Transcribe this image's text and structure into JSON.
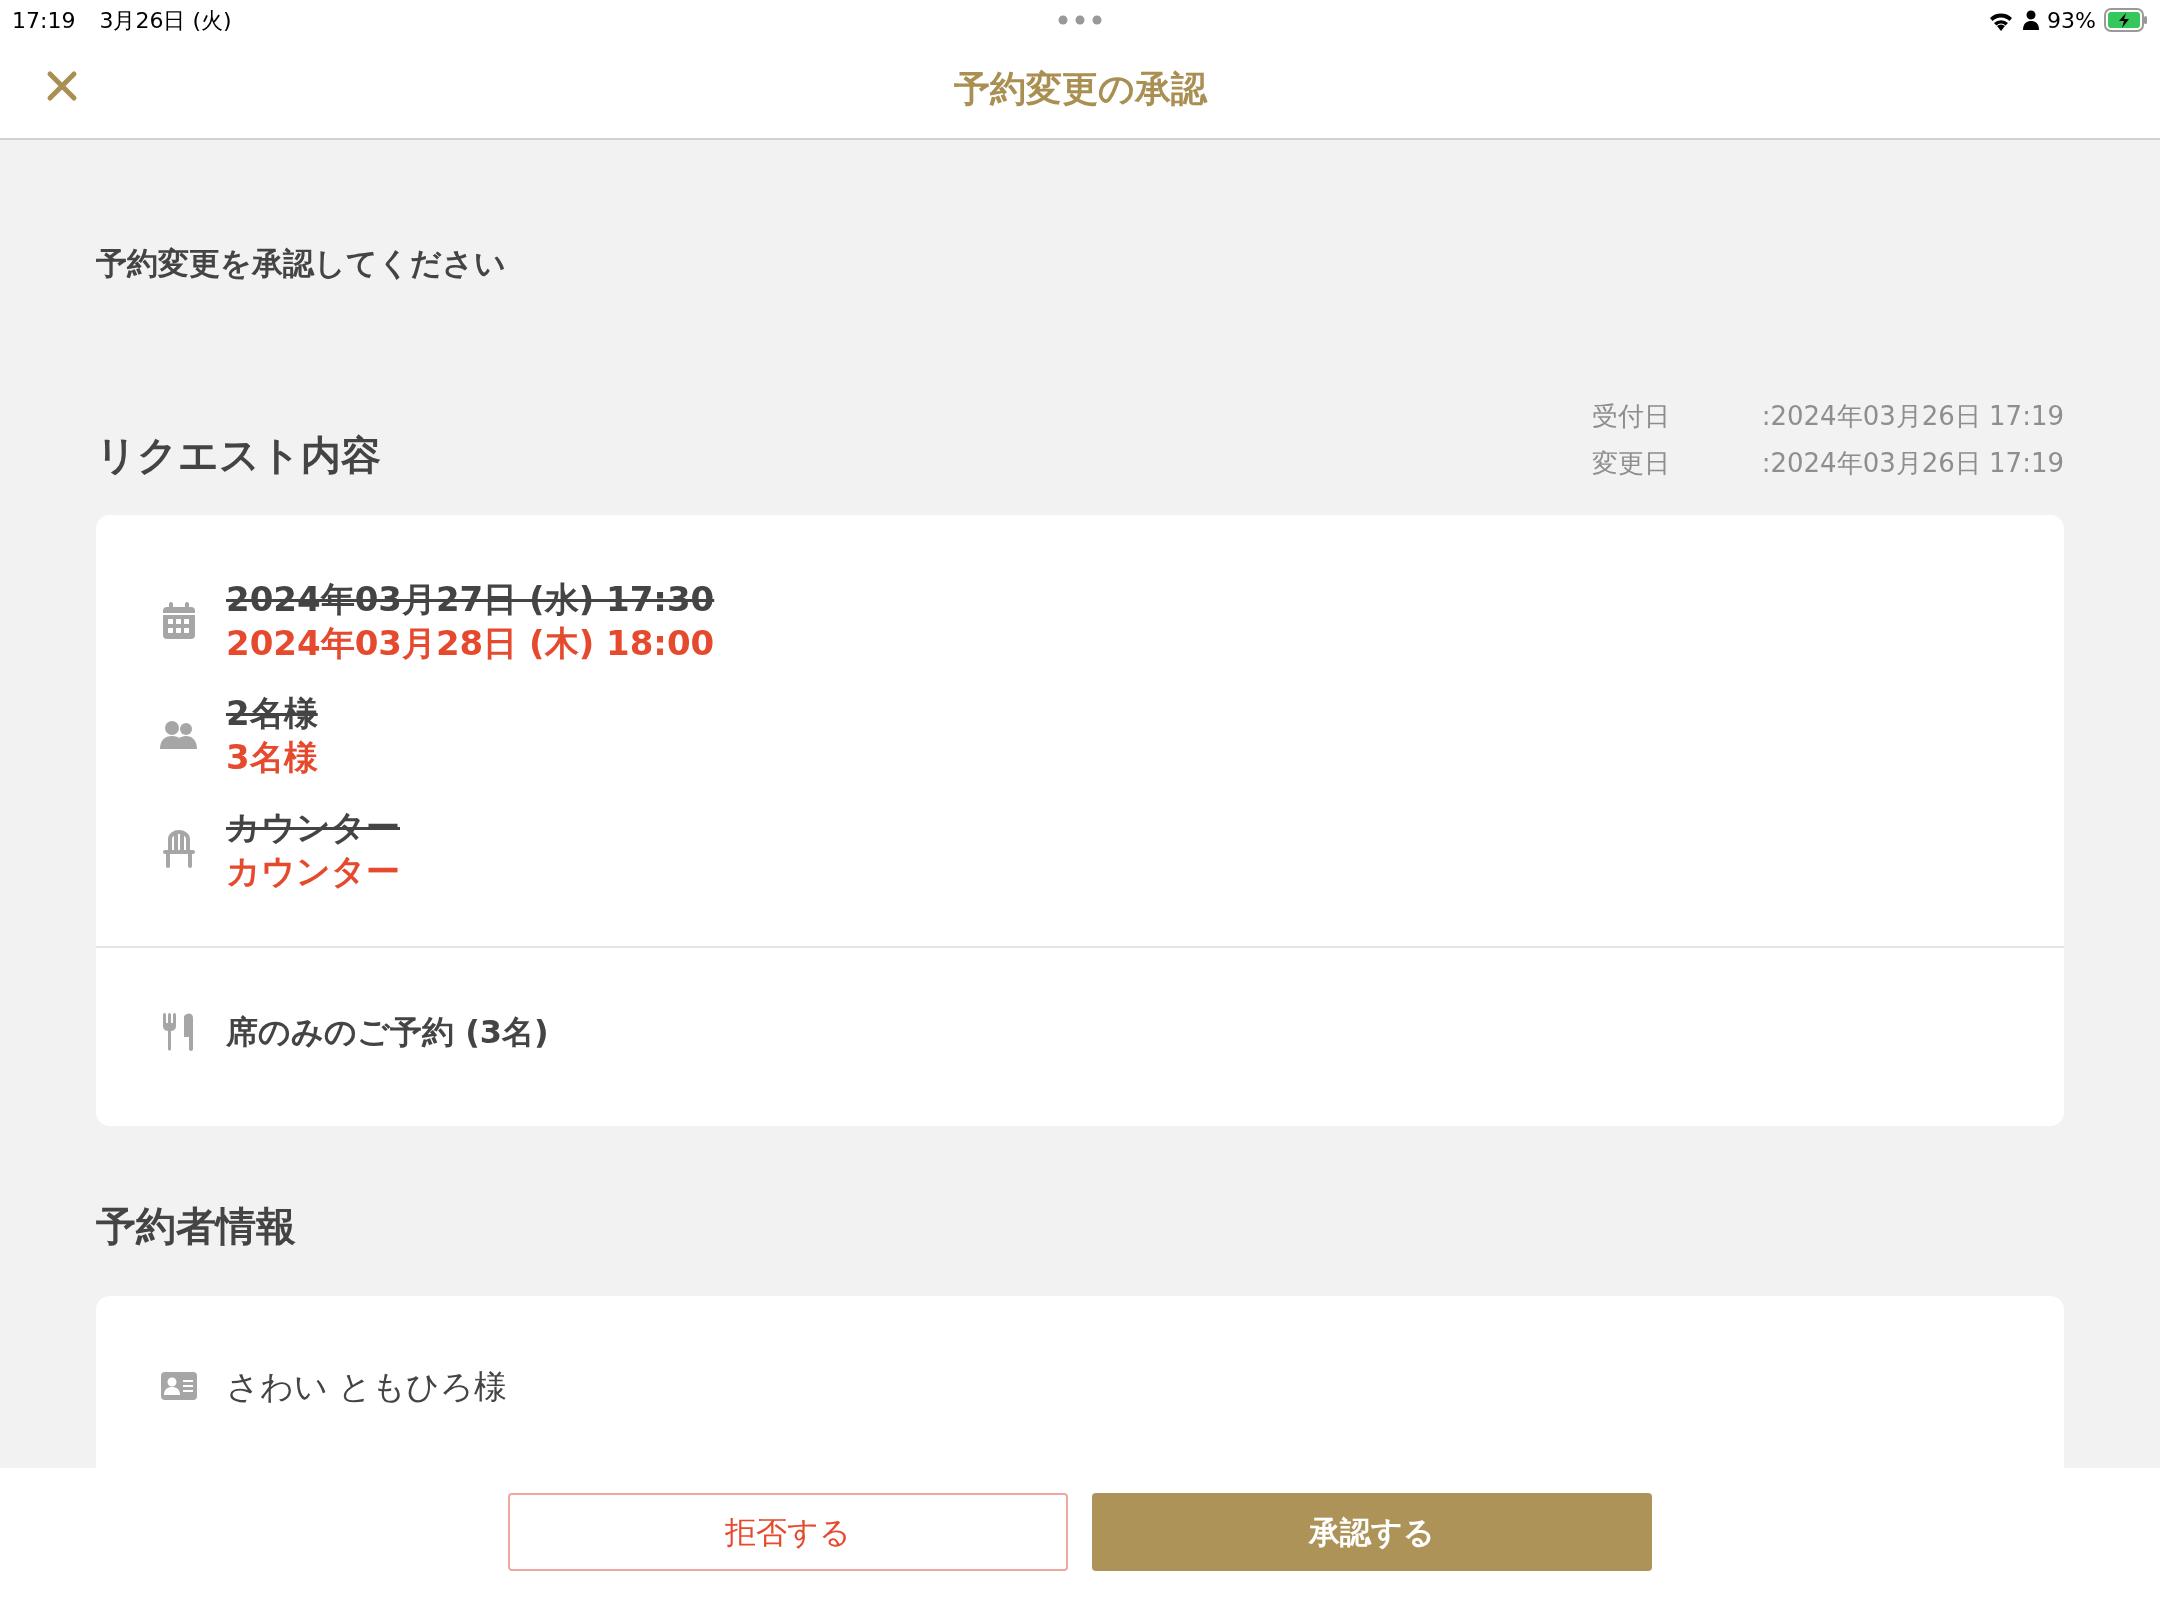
{
  "status_bar": {
    "time": "17:19",
    "date": "3月26日 (火)",
    "battery": "93%"
  },
  "header": {
    "title": "予約変更の承認"
  },
  "prompt": "予約変更を承認してください",
  "request": {
    "heading": "リクエスト内容",
    "meta": [
      {
        "label": "受付日",
        "value": ":2024年03月26日 17:19"
      },
      {
        "label": "変更日",
        "value": ":2024年03月26日 17:19"
      }
    ],
    "changes": [
      {
        "kind": "calendar",
        "old": "2024年03月27日 (水) 17:30",
        "new": "2024年03月28日 (木) 18:00"
      },
      {
        "kind": "people",
        "old": "2名様",
        "new": "3名様"
      },
      {
        "kind": "seat",
        "old": "カウンター",
        "new": "カウンター"
      }
    ],
    "course": {
      "kind": "dining",
      "text": "席のみのご予約 (3名)"
    }
  },
  "booker": {
    "heading": "予約者情報",
    "name": {
      "kind": "card",
      "text": "さわい ともひろ様"
    }
  },
  "buttons": [
    {
      "kind": "reject",
      "label": "拒否する"
    },
    {
      "kind": "approve",
      "label": "承認する"
    }
  ]
}
